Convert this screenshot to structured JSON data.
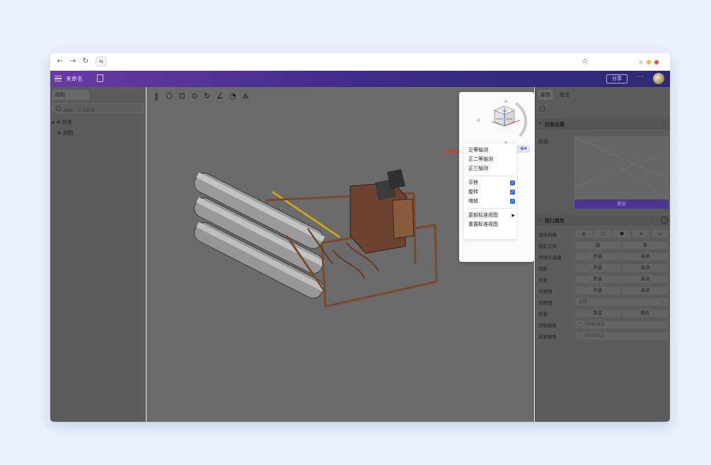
{
  "browser": {
    "back": "←",
    "forward": "→",
    "reload": "↻",
    "site_info": "⇆",
    "bookmark": "☆",
    "window_dots": [
      "#d9d9d9",
      "#f5b52d",
      "#ee4a4a"
    ]
  },
  "appbar": {
    "title": "未命名",
    "share_label": "分享",
    "more_label": "···"
  },
  "left_panel": {
    "tab": "结构",
    "search_placeholder": "请输入节点名称",
    "tree": [
      {
        "label": "▸ ⊕ 场景"
      },
      {
        "label": "⊕ 视图"
      }
    ]
  },
  "viewport": {
    "toolbar_icons": [
      "panel-toggle-icon",
      "cube-view-icon",
      "fit-view-icon",
      "focus-icon",
      "rotate-icon",
      "measure-icon",
      "section-icon",
      "explode-icon"
    ]
  },
  "view_menu": {
    "button_label": "⊕▾",
    "cube_faces": {
      "top": "TOP",
      "front": "FRONT",
      "right": "RIGHT"
    },
    "items": [
      {
        "label": "正等轴测"
      },
      {
        "label": "正二等轴测"
      },
      {
        "label": "正三轴测"
      },
      {
        "label": "平移",
        "checked": true
      },
      {
        "label": "旋转",
        "checked": true
      },
      {
        "label": "缩放",
        "checked": true
      },
      {
        "label": "更新标准视图",
        "submenu": true
      },
      {
        "label": "重置标准视图"
      }
    ],
    "check_glyph": "✓",
    "submenu_glyph": "▶"
  },
  "right_panel": {
    "tabs": [
      "属性",
      "批注"
    ],
    "cover_section": {
      "title": "封面设置",
      "label": "封面",
      "update_button": "更新"
    },
    "viewport_section": {
      "title": "视口属性",
      "help": "?"
    },
    "props": [
      {
        "label": "渲染风格",
        "type": "icons",
        "icons": [
          "shaded-icon",
          "wireframe-icon",
          "shaded-edges-icon",
          "hidden-line-icon",
          "screen-icon"
        ]
      },
      {
        "label": "投影方式",
        "type": "icons2",
        "icons": [
          "perspective-icon",
          "orthographic-icon"
        ]
      },
      {
        "label": "环境光遮蔽",
        "type": "toggle",
        "on": "开启",
        "off": "关闭"
      },
      {
        "label": "阴影",
        "type": "toggle",
        "on": "开启",
        "off": "关闭"
      },
      {
        "label": "反射",
        "type": "toggle",
        "on": "开启",
        "off": "关闭"
      },
      {
        "label": "反射图",
        "type": "toggle",
        "on": "开启",
        "off": "关闭"
      },
      {
        "label": "反射图",
        "type": "select",
        "value": "上传"
      },
      {
        "label": "背景",
        "type": "choice",
        "a": "渐变",
        "b": "图片"
      },
      {
        "label": "顶部颜色",
        "type": "color",
        "value": "EDEDED"
      },
      {
        "label": "底部颜色",
        "type": "color",
        "value": "EDEDED"
      }
    ]
  }
}
